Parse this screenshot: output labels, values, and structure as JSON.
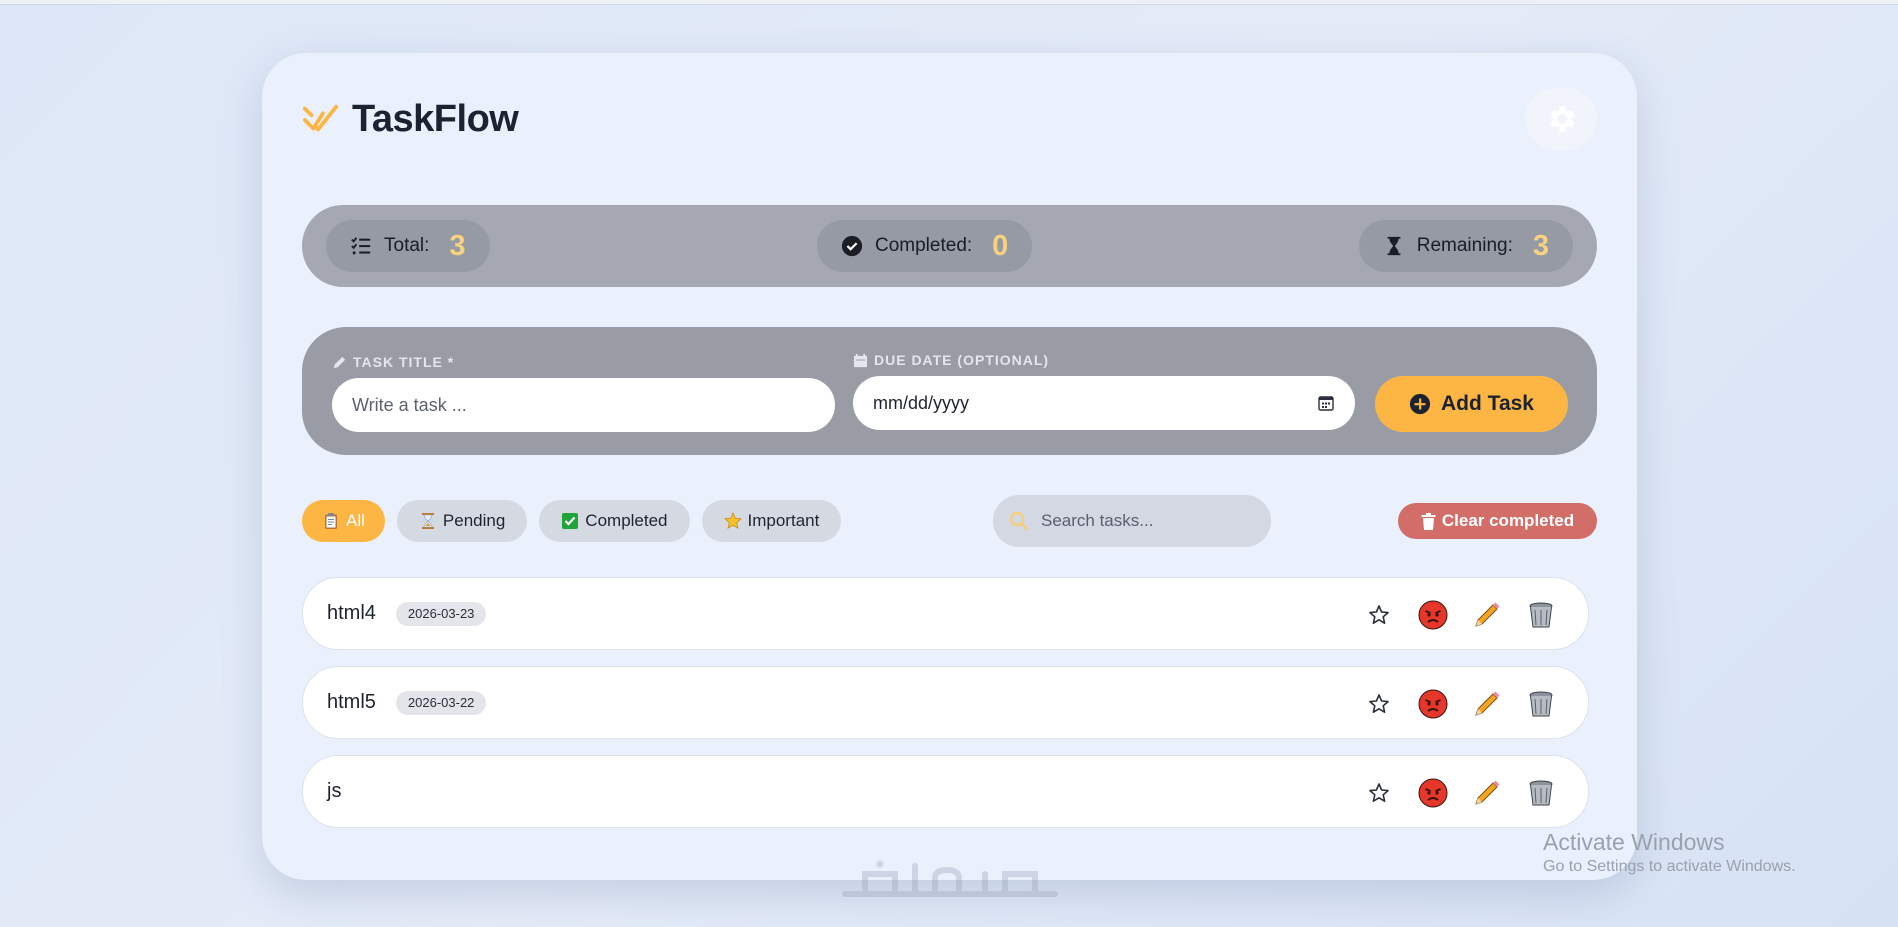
{
  "app": {
    "name": "TaskFlow"
  },
  "colors": {
    "accent": "#fdb544",
    "danger": "#d26d68",
    "stat_number": "#f8d27e"
  },
  "stats": {
    "total_label": "Total:",
    "total_value": "3",
    "completed_label": "Completed:",
    "completed_value": "0",
    "remaining_label": "Remaining:",
    "remaining_value": "3"
  },
  "form": {
    "title_label": "Task Title *",
    "title_placeholder": "Write a task ...",
    "date_label": "Due Date (Optional)",
    "date_value": "mm/dd/yyyy",
    "add_label": "Add Task"
  },
  "filters": [
    {
      "label": "All",
      "icon": "clipboard-icon",
      "active": true
    },
    {
      "label": "Pending",
      "icon": "hourglass-icon",
      "active": false
    },
    {
      "label": "Completed",
      "icon": "check-box-icon",
      "active": false
    },
    {
      "label": "Important",
      "icon": "star-icon",
      "active": false
    }
  ],
  "search": {
    "placeholder": "Search tasks..."
  },
  "clear_label": "Clear completed",
  "tasks": [
    {
      "title": "html4",
      "date": "2026-03-23"
    },
    {
      "title": "html5",
      "date": "2026-03-22"
    },
    {
      "title": "js",
      "date": ""
    }
  ],
  "watermark": {
    "line1": "Activate Windows",
    "line2": "Go to Settings to activate Windows."
  }
}
